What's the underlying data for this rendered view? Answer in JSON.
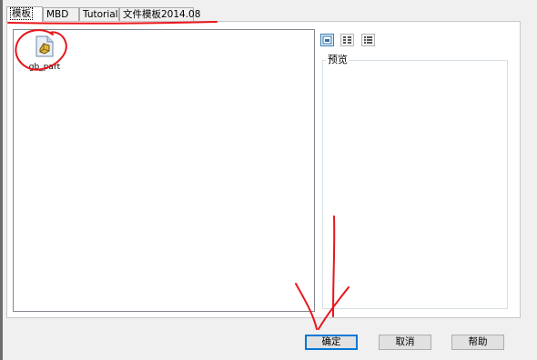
{
  "tabs": [
    {
      "label": "模板",
      "active": true
    },
    {
      "label": "MBD",
      "active": false
    },
    {
      "label": "Tutorial",
      "active": false
    },
    {
      "label": "文件模板2014.08",
      "active": false
    }
  ],
  "files": [
    {
      "name": "gb_part",
      "icon": "part-document-icon"
    }
  ],
  "view_buttons": [
    {
      "name": "large-icons-view-icon",
      "active": true
    },
    {
      "name": "list-view-icon",
      "active": false
    },
    {
      "name": "details-view-icon",
      "active": false
    }
  ],
  "preview": {
    "label": "预览"
  },
  "buttons": {
    "ok": "确定",
    "cancel": "取消",
    "help": "帮助"
  },
  "annotation_color": "#e8161b"
}
